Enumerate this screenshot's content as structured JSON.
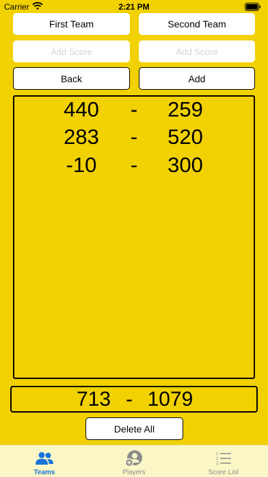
{
  "status_bar": {
    "carrier": "Carrier",
    "time": "2:21 PM"
  },
  "team_buttons": {
    "first": "First Team",
    "second": "Second Team"
  },
  "inputs": {
    "first_placeholder": "Add Score",
    "second_placeholder": "Add Score"
  },
  "actions": {
    "back": "Back",
    "add": "Add"
  },
  "scores": [
    {
      "first": "440",
      "sep": "-",
      "second": "259"
    },
    {
      "first": "283",
      "sep": "-",
      "second": "520"
    },
    {
      "first": "-10",
      "sep": "-",
      "second": "300"
    }
  ],
  "totals": {
    "first": "713",
    "sep": "-",
    "second": "1079"
  },
  "delete_all": "Delete All",
  "tabs": [
    {
      "label": "Teams",
      "icon": "teams-icon",
      "active": true
    },
    {
      "label": "Players",
      "icon": "add-player-icon",
      "active": false
    },
    {
      "label": "Score List",
      "icon": "list-icon",
      "active": false
    }
  ],
  "colors": {
    "background": "#f1d100",
    "accent": "#1a73d9",
    "tabbar": "#fbf6c6"
  }
}
